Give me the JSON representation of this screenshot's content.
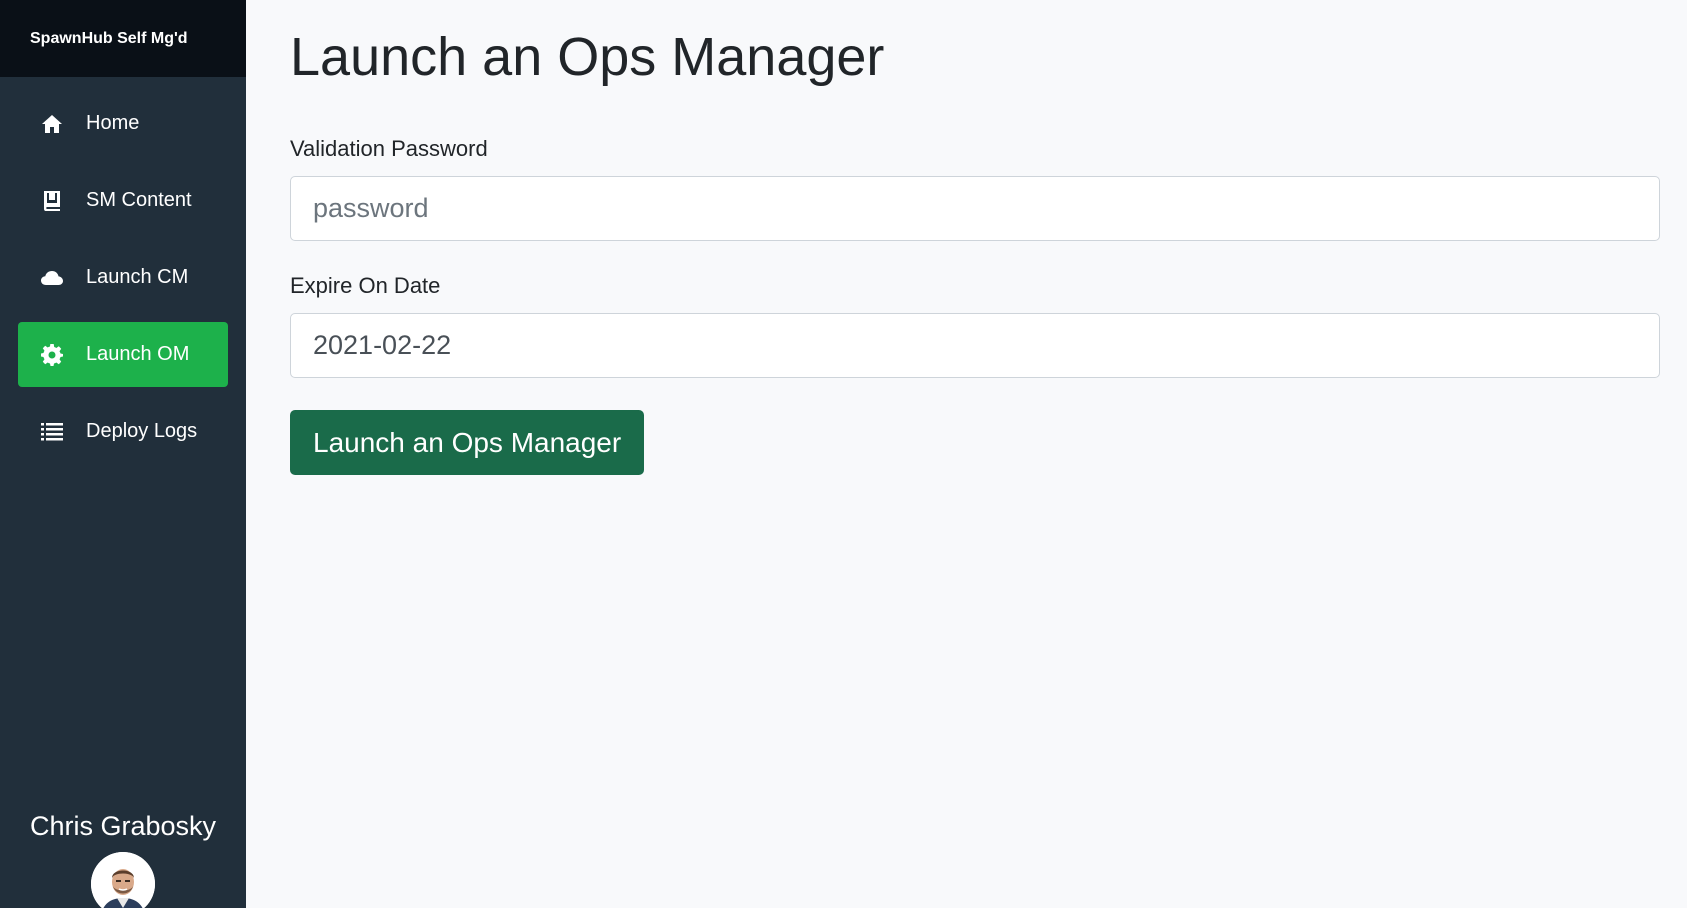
{
  "sidebar": {
    "brand": "SpawnHub Self Mg'd",
    "items": [
      {
        "label": "Home",
        "icon": "home-icon",
        "active": false
      },
      {
        "label": "SM Content",
        "icon": "book-icon",
        "active": false
      },
      {
        "label": "Launch CM",
        "icon": "cloud-icon",
        "active": false
      },
      {
        "label": "Launch OM",
        "icon": "gear-icon",
        "active": true
      },
      {
        "label": "Deploy Logs",
        "icon": "list-icon",
        "active": false
      }
    ],
    "user_name": "Chris Grabosky"
  },
  "main": {
    "title": "Launch an Ops Manager",
    "password": {
      "label": "Validation Password",
      "placeholder": "password",
      "value": ""
    },
    "expire": {
      "label": "Expire On Date",
      "value": "2021-02-22"
    },
    "submit_label": "Launch an Ops Manager"
  },
  "colors": {
    "sidebar_bg": "#212f3b",
    "brand_bg": "#0a1017",
    "active_bg": "#1db14b",
    "button_bg": "#1a6b4a",
    "page_bg": "#f8f9fb"
  }
}
